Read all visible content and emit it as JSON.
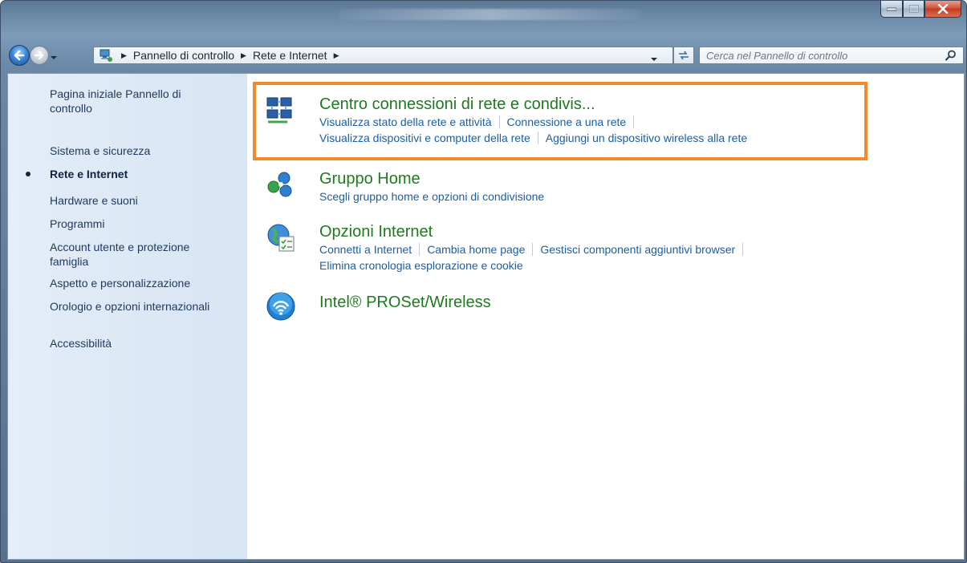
{
  "window": {
    "buttons": {
      "minimize": "minimize",
      "maximize": "maximize",
      "close": "close"
    }
  },
  "address": {
    "crumbs": [
      "Pannello di controllo",
      "Rete e Internet"
    ],
    "search_placeholder": "Cerca nel Pannello di controllo"
  },
  "sidebar": {
    "items": [
      {
        "label": "Pagina iniziale Pannello di controllo"
      },
      {
        "label": "Sistema e sicurezza"
      },
      {
        "label": "Rete e Internet",
        "active": true
      },
      {
        "label": "Hardware e suoni"
      },
      {
        "label": "Programmi"
      },
      {
        "label": "Account utente e protezione famiglia"
      },
      {
        "label": "Aspetto e personalizzazione"
      },
      {
        "label": "Orologio e opzioni internazionali"
      },
      {
        "label": "Accessibilità"
      }
    ]
  },
  "categories": [
    {
      "title": "Centro connessioni di rete e condivis...",
      "icon": "network-center-icon",
      "links_row1": [
        "Visualizza stato della rete e attività",
        "Connessione a una rete"
      ],
      "links_row2": [
        "Visualizza dispositivi e computer della rete",
        "Aggiungi un dispositivo wireless alla rete"
      ]
    },
    {
      "title": "Gruppo Home",
      "icon": "homegroup-icon",
      "links_row1": [
        "Scegli gruppo home e opzioni di condivisione"
      ]
    },
    {
      "title": "Opzioni Internet",
      "icon": "internet-options-icon",
      "links_row1": [
        "Connetti a Internet",
        "Cambia home page",
        "Gestisci componenti aggiuntivi browser"
      ],
      "links_row2": [
        "Elimina cronologia esplorazione e cookie"
      ]
    },
    {
      "title": "Intel® PROSet/Wireless",
      "icon": "wireless-icon"
    }
  ],
  "colors": {
    "highlight": "#f08a2a",
    "category_title": "#1e7a1e",
    "link": "#1a5fa3",
    "sidebar_text": "#1e395b"
  }
}
